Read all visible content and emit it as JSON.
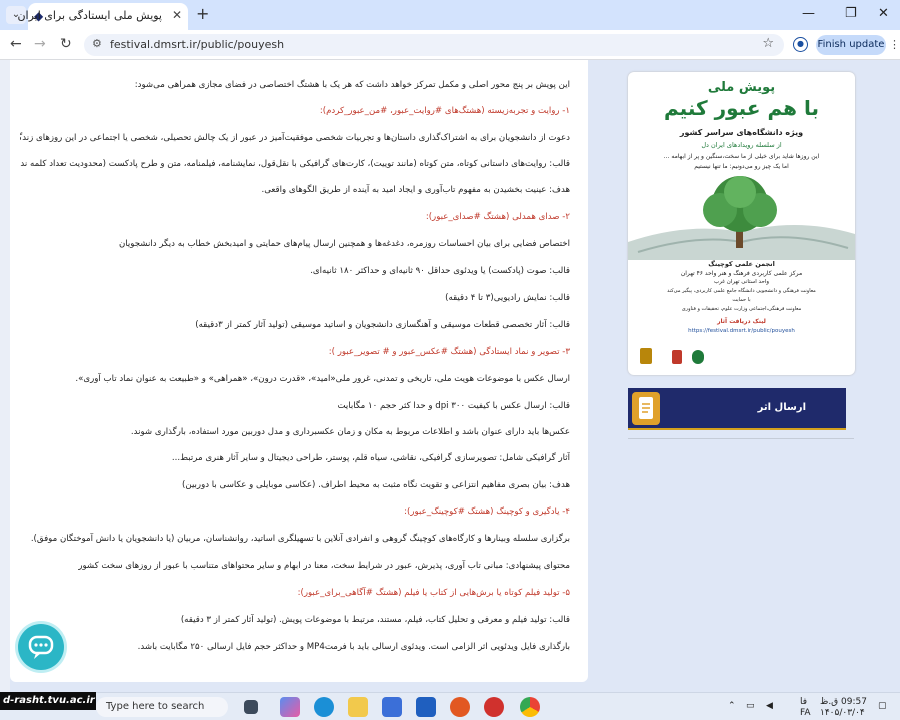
{
  "tab": {
    "title": "پویش ملی ایستادگی برای ایران"
  },
  "address": {
    "url": "festival.dmsrt.ir/public/pouyesh"
  },
  "toolbar": {
    "finish_update": "Finish update"
  },
  "article": {
    "lines": [
      {
        "text": "این پویش بر پنج محور اصلی و مکمل تمرکز خواهد داشت که هر یک با هشتگ اختصاصی در فضای مجازی همراهی می‌شود:",
        "style": "normal"
      },
      {
        "text": "۱- روایت و تجربه‌زیسته (هشتگ‌های #روایت_عبور، #من_عبور_کردم):",
        "style": "red"
      },
      {
        "text": "دعوت از دانشجویان برای به اشتراک‌گذاری داستان‌ها و تجربیات شخصی موفقیت‌آمیز در عبور از یک چالش تحصیلی، شخصی یا اجتماعی در این روزهای زندگی",
        "style": "normal"
      },
      {
        "text": "قالب: روایت‌های داستانی کوتاه، متن کوتاه (مانند توییت)، کارت‌های گرافیکی با نقل‌قول، نمایشنامه، فیلمنامه، متن و طرح پادکست (محدودیت تعداد کلمه ندارد)",
        "style": "normal"
      },
      {
        "text": "هدف: عینیت بخشیدن به مفهوم تاب‌آوری و ایجاد امید به آینده از طریق الگوهای واقعی.",
        "style": "normal"
      },
      {
        "text": "۲- صدای همدلی (هشتگ #صدای_عبور):",
        "style": "red"
      },
      {
        "text": "اختصاص فضایی برای بیان احساسات روزمره، دغدغه‌ها و همچنین ارسال پیام‌های حمایتی و امیدبخش خطاب به دیگر دانشجویان",
        "style": "normal"
      },
      {
        "text": "قالب: صوت (پادکست) یا ویدئوی حداقل ۹۰ ثانیه‌ای و حداکثر ۱۸۰ ثانیه‌ای.",
        "style": "normal"
      },
      {
        "text": "قالب: نمایش رادیویی(۳ تا ۴ دقیقه)",
        "style": "normal"
      },
      {
        "text": "قالب: آثار تخصصی قطعات موسیقی و آهنگسازی دانشجویان و اساتید موسیقی (تولید آثار کمتر از ۳دقیقه)",
        "style": "normal"
      },
      {
        "text": "۳- تصویر و نماد ایستادگی (هشتگ #عکس_عبور و # تصویر_عبور ):",
        "style": "red"
      },
      {
        "text": "ارسال عکس با موضوعات هویت ملی، تاریخی و تمدنی، غرور ملی«امید»، «قدرت درون»، «همراهی» و «طبیعت به عنوان نماد تاب آوری».",
        "style": "normal"
      },
      {
        "text": "قالب: ارسال عکس  با کیفیت ۳۰۰ dpi و حدا کثر حجم ۱۰ مگابایت",
        "style": "normal"
      },
      {
        "text": "عکس‌ها باید دارای عنوان باشد و اطلاعات مربوط به مکان و زمان عکسبرداری و مدل دوربین مورد استفاده، بارگذاری شوند.",
        "style": "normal"
      },
      {
        "text": "آثار گرافیکی شامل: تصویرسازی گرافیکی، نقاشی، سیاه قلم، پوستر، طراحی دیجیتال و سایر آثار هنری مرتبط...",
        "style": "normal"
      },
      {
        "text": "هدف: بیان بصری مفاهیم انتزاعی و تقویت نگاه مثبت به محیط اطراف. (عکاسی موبایلی و عکاسی با دوربین)",
        "style": "normal"
      },
      {
        "text": "۴- یادگیری و کوچینگ (هشتگ #کوچینگ_عبور):",
        "style": "red"
      },
      {
        "text": "برگزاری سلسله وبینارها و کارگاه‌های کوچینگ گروهی و انفرادی آنلاین با تسهیلگری اساتید، روانشناسان، مربیان (یا دانشجویان یا دانش آموختگان موفق).",
        "style": "normal"
      },
      {
        "text": "محتوای پیشنهادی: مبانی تاب آوری، پذیرش، عبور در شرایط سخت، معنا در ابهام و سایر محتواهای متناسب با عبور از روزهای سخت کشور",
        "style": "normal"
      },
      {
        "text": "۵- تولید فیلم کوتاه یا  برش‌هایی از کتاب یا فیلم (هشتگ #آگاهی_برای_عبور):",
        "style": "red"
      },
      {
        "text": "قالب: تولید فیلم و معرفی و تحلیل کتاب، فیلم، مستند، مرتبط با موضوعات پویش. (تولید آثار کمتر از ۳ دقیقه)",
        "style": "normal"
      },
      {
        "text": "بارگذاری فایل ویدئویی اثر الزامی است. ویدئوی ارسالی باید با فرمتMP4 و حداکثر حجم فایل ارسالی ۲۵۰ مگابایت باشد.",
        "style": "normal"
      }
    ]
  },
  "poster": {
    "kicker": "پویش ملی",
    "headline": "با هم عبور کنیم",
    "subtitle": "ویژه دانشگاه‌های سراسر کشور",
    "series": "از سلسله رویدادهای ایران دل",
    "quote1": "این روزها شاید برای خیلی از ما سخت،سنگین و پر از ابهامه ...",
    "quote2": "اما یک چیز رو می‌دونیم: ما تنها نیستیم",
    "org1": "انجمن علمی کوچینگ",
    "org2": "مرکز علمی کاربردی فرهنگ و هنر واحد ۴۶ تهران",
    "org3": "واحد استانی تهران غرب",
    "org4": "معاونت فرهنگی و دانشجویی دانشگاه جامع علمی کاربردی، پیگیر می‌کند",
    "org5": "با حمایت",
    "org6": "معاونت فرهنگی،اجتماعی وزارت علوم، تحقیقات و فناوری",
    "link_label": "لینک دریافت آثار",
    "link_url": "https://festival.dmsrt.ir/public/pouyesh"
  },
  "sidebar": {
    "send_work": "ارسال اثر"
  },
  "watermark": {
    "text": "d-rasht.tvu.ac.ir"
  },
  "taskbar": {
    "search_placeholder": "Type here to search",
    "lang1": "فا",
    "lang2": "FA",
    "time": "09:57 ق.ظ",
    "date": "۱۴۰۵/۰۳/۰۴"
  },
  "colors": {
    "accent_red": "#c0392b",
    "accent_blue": "#1f4e9b",
    "poster_green": "#1f7a3a",
    "sidebar_navy": "#1f2a6b"
  },
  "icons": {
    "favicon": "diamond-logo-icon",
    "chat": "chat-bubble-icon",
    "document": "document-icon"
  }
}
